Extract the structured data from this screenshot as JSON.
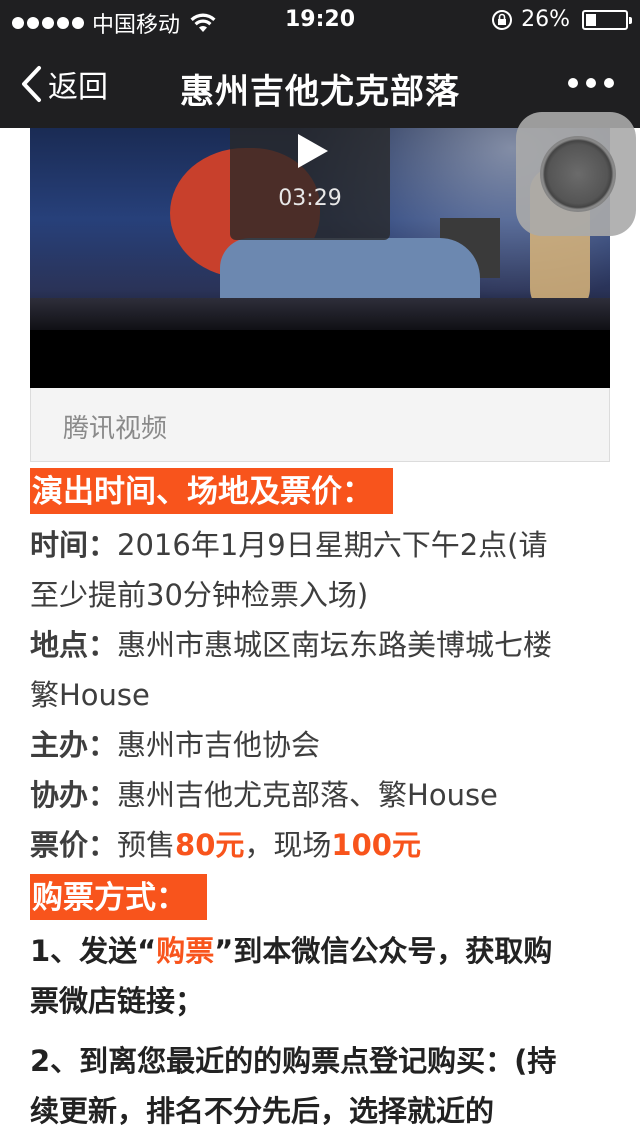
{
  "status_bar": {
    "carrier": "中国移动",
    "time": "19:20",
    "battery": "26%",
    "battery_level": 0.26
  },
  "nav": {
    "back_label": "返回",
    "title": "惠州吉他尤克部落"
  },
  "video": {
    "duration": "03:29",
    "source_label": "腾讯视频"
  },
  "article": {
    "section1_heading": "演出时间、场地及票价：",
    "time_label": "时间：",
    "time_value_1": "2016年1月9日星期六下午2点(请",
    "time_value_2": "至少提前30分钟检票入场)",
    "venue_label": "地点：",
    "venue_value_1": "惠州市惠城区南坛东路美博城七楼",
    "venue_value_2": "繁House",
    "host_label": "主办：",
    "host_value": "惠州市吉他协会",
    "co_label": "协办：",
    "co_value": "惠州吉他尤克部落、繁House",
    "price_label": "票价：",
    "price_pre": "预售",
    "price_presale": "80元",
    "price_mid": "，现场",
    "price_door": "100元",
    "section2_heading": "购票方式：",
    "m1_a": "1、发送“",
    "m1_keyword": "购票",
    "m1_b": "”到本微信公众号，获取购",
    "m1_c": "票微店链接；",
    "m2_a": "2、到离您最近的的购票点登记购买：(持",
    "m2_b": "续更新，排名不分先后，选择就近的"
  },
  "colors": {
    "accent": "#f8541c",
    "topbar": "#1f1f21"
  },
  "icons": [
    "wifi-icon",
    "rotation-lock-icon",
    "battery-icon",
    "back-chevron-icon",
    "more-icon",
    "play-icon"
  ]
}
